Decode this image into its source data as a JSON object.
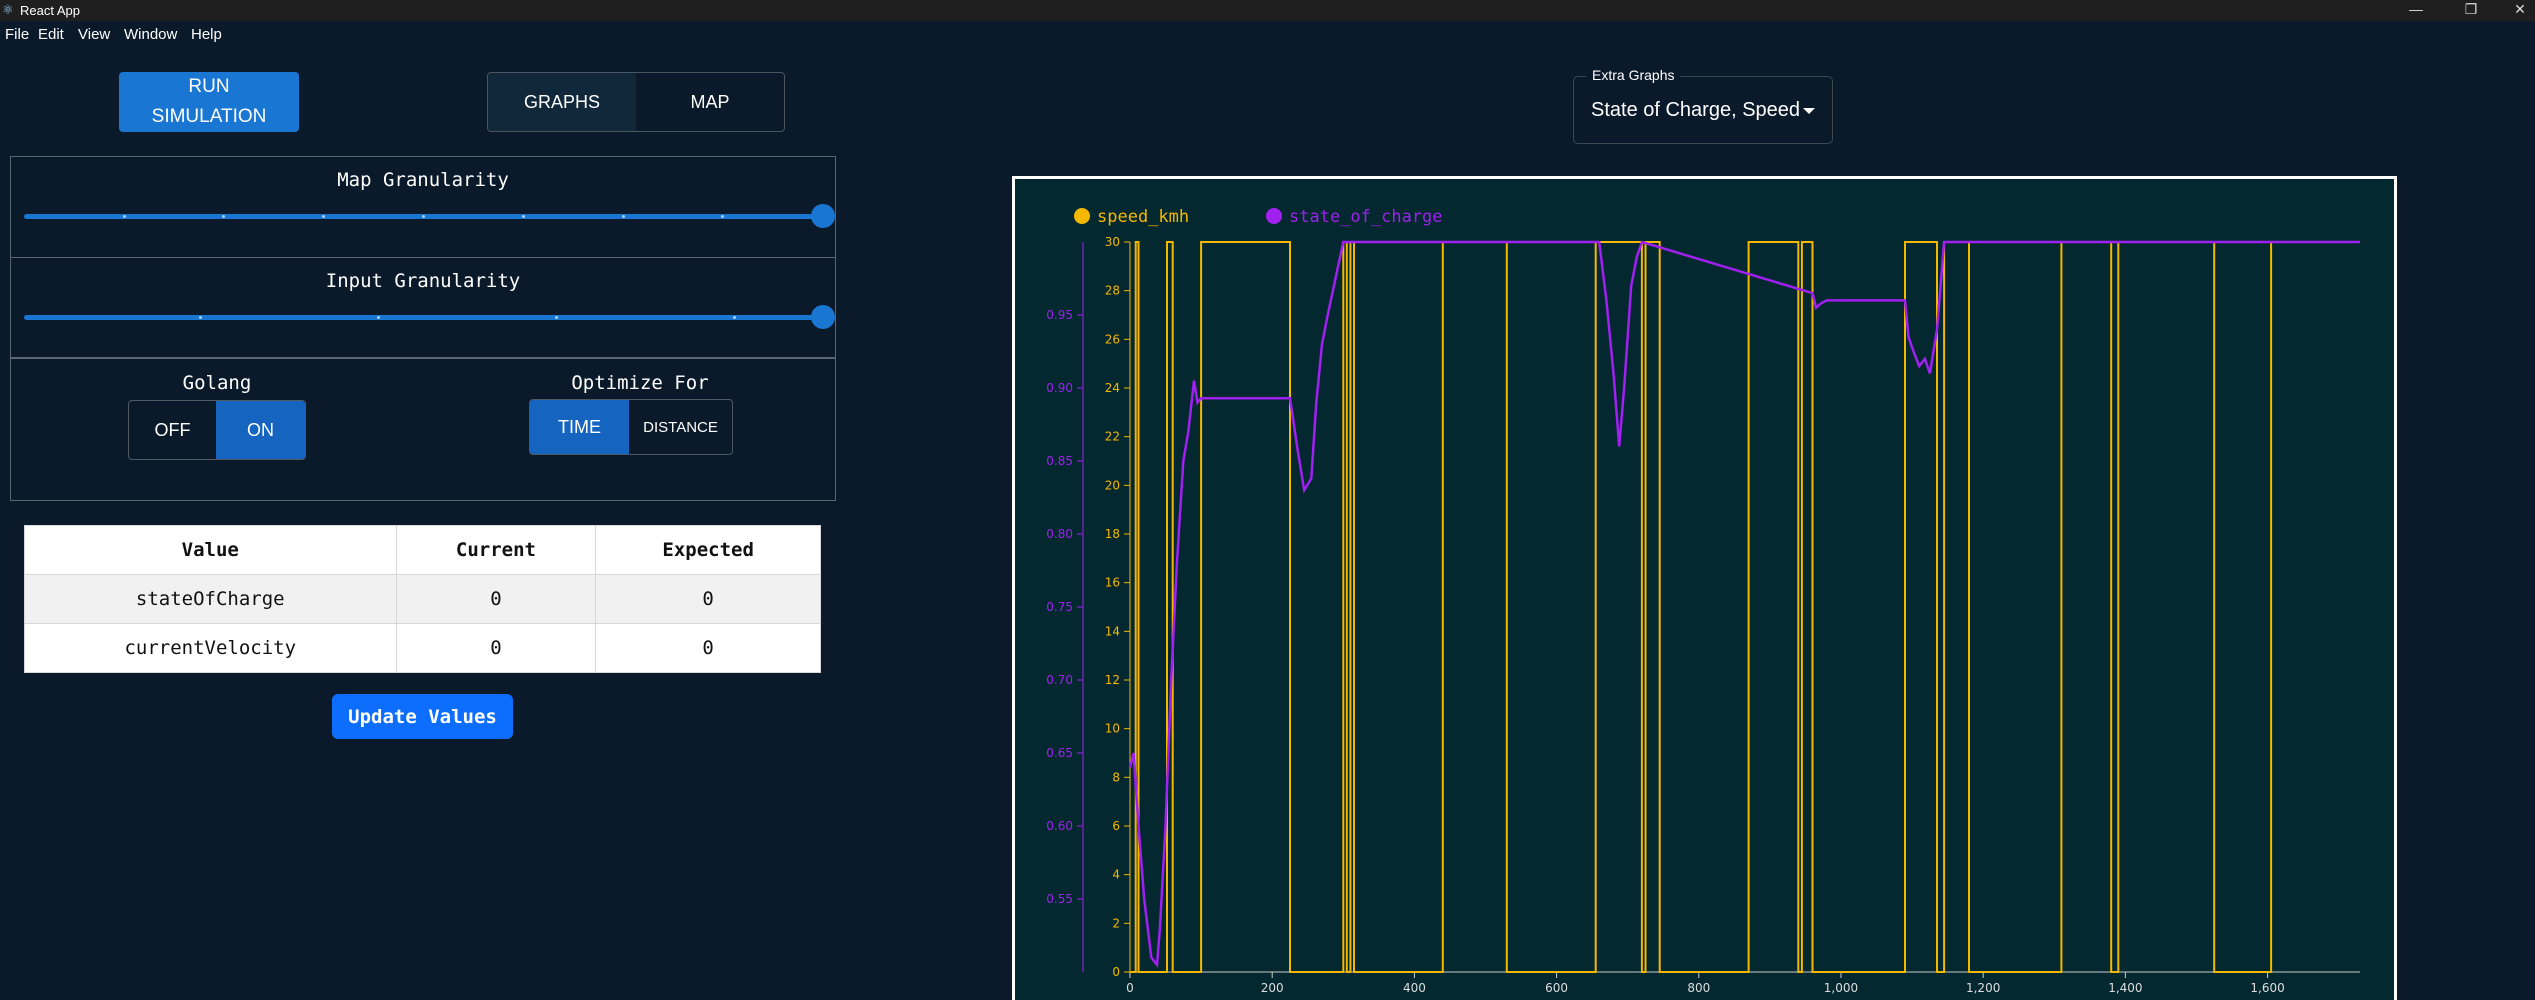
{
  "window": {
    "title": "React App",
    "min_glyph": "—",
    "max_glyph": "❐",
    "close_glyph": "✕"
  },
  "menu": [
    "File",
    "Edit",
    "View",
    "Window",
    "Help"
  ],
  "toolbar": {
    "run_line1": "RUN",
    "run_line2": "SIMULATION",
    "tab_graphs": "GRAPHS",
    "tab_map": "MAP"
  },
  "extra_graphs": {
    "label": "Extra Graphs",
    "value": "State of Charge, Speed"
  },
  "map_granularity": {
    "label": "Map Granularity",
    "value": 1.0
  },
  "input_granularity": {
    "label": "Input Granularity",
    "value": 1.0
  },
  "golang": {
    "label": "Golang",
    "off": "OFF",
    "on": "ON",
    "selected": "ON"
  },
  "optimize": {
    "label": "Optimize For",
    "time": "TIME",
    "distance": "DISTANCE",
    "selected": "TIME"
  },
  "table": {
    "headers": [
      "Value",
      "Current",
      "Expected"
    ],
    "rows": [
      [
        "stateOfCharge",
        "0",
        "0"
      ],
      [
        "currentVelocity",
        "0",
        "0"
      ]
    ]
  },
  "update_label": "Update Values",
  "colors": {
    "speed": "#f5b800",
    "soc": "#a020f0",
    "accent": "#1976d2"
  },
  "chart_data": {
    "type": "line",
    "title": "",
    "legend": [
      "speed_kmh",
      "state_of_charge"
    ],
    "legend_position": "top-left",
    "grid": false,
    "xlim": [
      0,
      1730
    ],
    "x_ticks": [
      0,
      200,
      400,
      600,
      800,
      "1,000",
      "1,200",
      "1,400",
      "1,600"
    ],
    "y_left_lim": [
      0,
      30
    ],
    "y_left_ticks": [
      0,
      2,
      4,
      6,
      8,
      10,
      12,
      14,
      16,
      18,
      20,
      22,
      24,
      26,
      28,
      30
    ],
    "y_right_lim": [
      0.5,
      1.0
    ],
    "y_right_ticks": [
      "0.55",
      "0.60",
      "0.65",
      "0.70",
      "0.75",
      "0.80",
      "0.85",
      "0.90",
      "0.95"
    ],
    "series": [
      {
        "name": "speed_kmh",
        "axis": "left",
        "x": [
          0,
          8,
          8,
          12,
          12,
          52,
          52,
          60,
          60,
          100,
          100,
          225,
          225,
          300,
          300,
          305,
          305,
          310,
          310,
          315,
          315,
          440,
          440,
          530,
          530,
          655,
          655,
          720,
          720,
          725,
          725,
          745,
          745,
          870,
          870,
          940,
          940,
          945,
          945,
          960,
          960,
          1090,
          1090,
          1135,
          1135,
          1145,
          1145,
          1180,
          1180,
          1310,
          1310,
          1380,
          1380,
          1390,
          1390,
          1525,
          1525,
          1605,
          1605,
          1730
        ],
        "y": [
          0,
          0,
          30,
          30,
          0,
          0,
          30,
          30,
          0,
          0,
          30,
          30,
          0,
          0,
          30,
          30,
          0,
          0,
          30,
          30,
          0,
          0,
          30,
          30,
          0,
          0,
          30,
          30,
          0,
          0,
          30,
          30,
          0,
          0,
          30,
          30,
          0,
          0,
          30,
          30,
          0,
          0,
          30,
          30,
          0,
          0,
          30,
          30,
          0,
          0,
          30,
          30,
          0,
          0,
          30,
          30,
          0,
          0,
          30,
          30
        ]
      },
      {
        "name": "state_of_charge",
        "axis": "right",
        "x": [
          0,
          5,
          12,
          20,
          30,
          38,
          42,
          50,
          58,
          66,
          75,
          82,
          90,
          95,
          100,
          225,
          235,
          245,
          255,
          262,
          270,
          278,
          300,
          660,
          670,
          680,
          688,
          695,
          705,
          713,
          720,
          960,
          965,
          972,
          980,
          1090,
          1095,
          1102,
          1110,
          1118,
          1125,
          1135,
          1145,
          1160,
          1730
        ],
        "y": [
          0.64,
          0.65,
          0.6,
          0.55,
          0.51,
          0.505,
          0.53,
          0.6,
          0.7,
          0.78,
          0.85,
          0.87,
          0.905,
          0.89,
          0.893,
          0.893,
          0.86,
          0.83,
          0.838,
          0.89,
          0.93,
          0.95,
          1.0,
          1.0,
          0.96,
          0.91,
          0.86,
          0.9,
          0.97,
          0.99,
          1.0,
          0.965,
          0.955,
          0.958,
          0.96,
          0.96,
          0.935,
          0.925,
          0.915,
          0.92,
          0.91,
          0.94,
          1.0,
          1.0,
          1.0
        ]
      }
    ]
  }
}
